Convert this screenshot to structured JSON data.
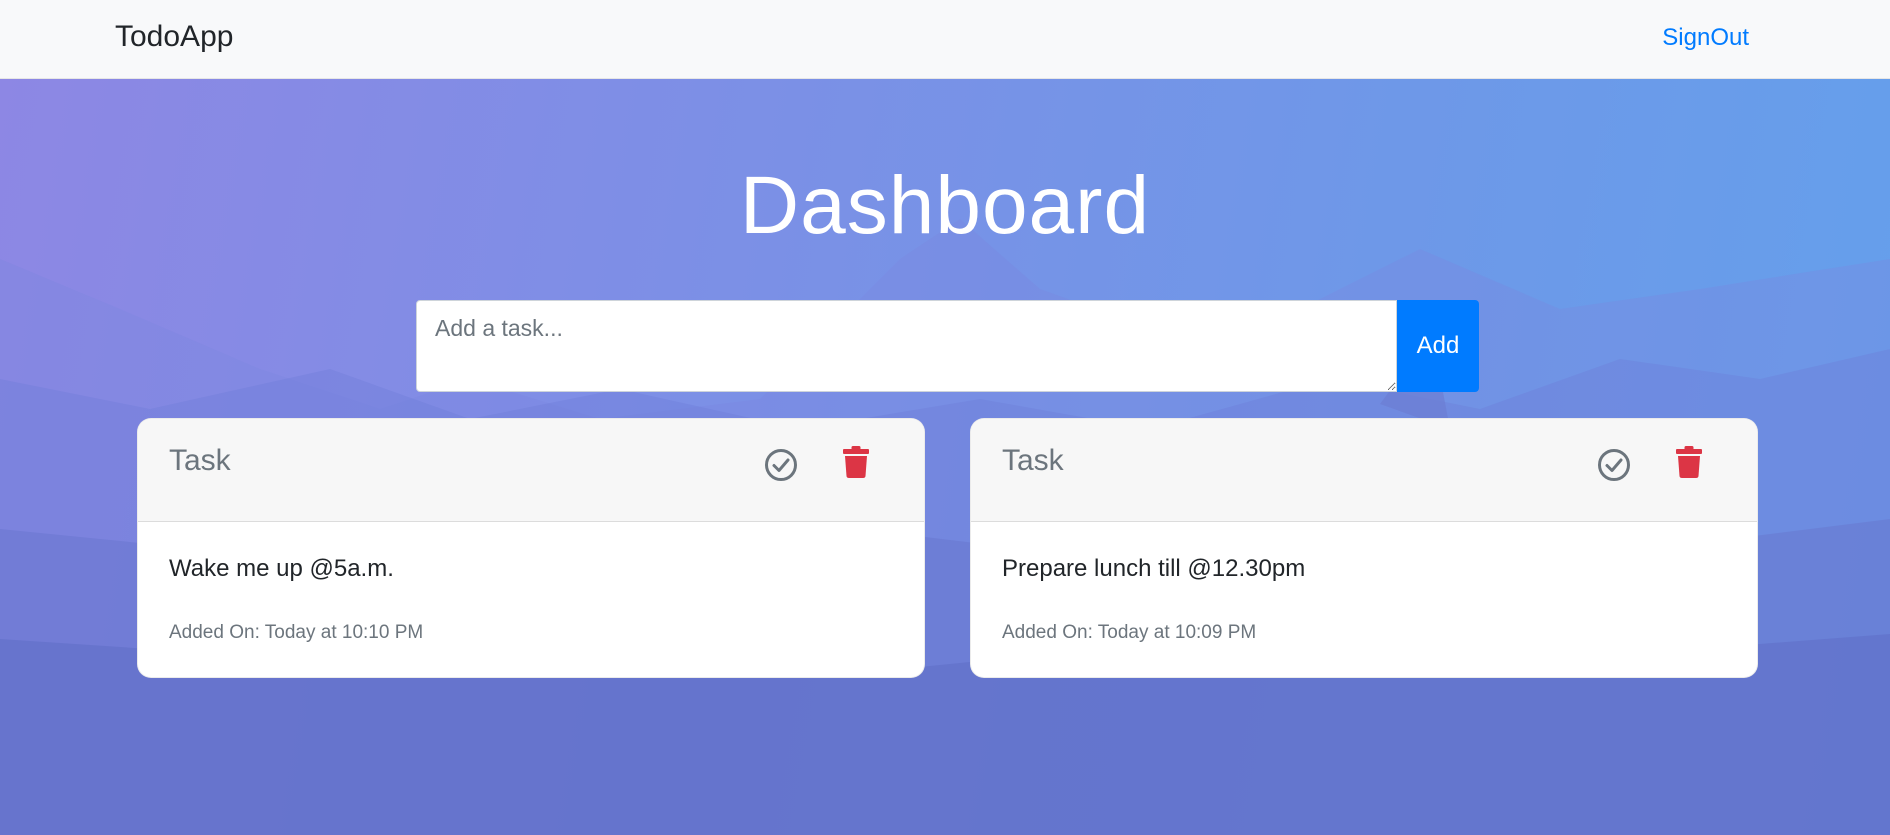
{
  "navbar": {
    "brand": "TodoApp",
    "signout_label": "SignOut"
  },
  "main": {
    "title": "Dashboard",
    "task_input": {
      "placeholder": "Add a task...",
      "value": ""
    },
    "add_label": "Add"
  },
  "tasks": [
    {
      "header": "Task",
      "text": "Wake me up @5a.m.",
      "added_on": "Added On: Today at 10:10 PM"
    },
    {
      "header": "Task",
      "text": "Prepare lunch till @12.30pm",
      "added_on": "Added On: Today at 10:09 PM"
    }
  ],
  "icons": {
    "complete": "check-circle-icon",
    "delete": "trash-icon"
  },
  "colors": {
    "accent": "#007bff",
    "danger": "#dc3545",
    "muted": "#6c757d",
    "navbar_bg": "#f8f9fa"
  }
}
